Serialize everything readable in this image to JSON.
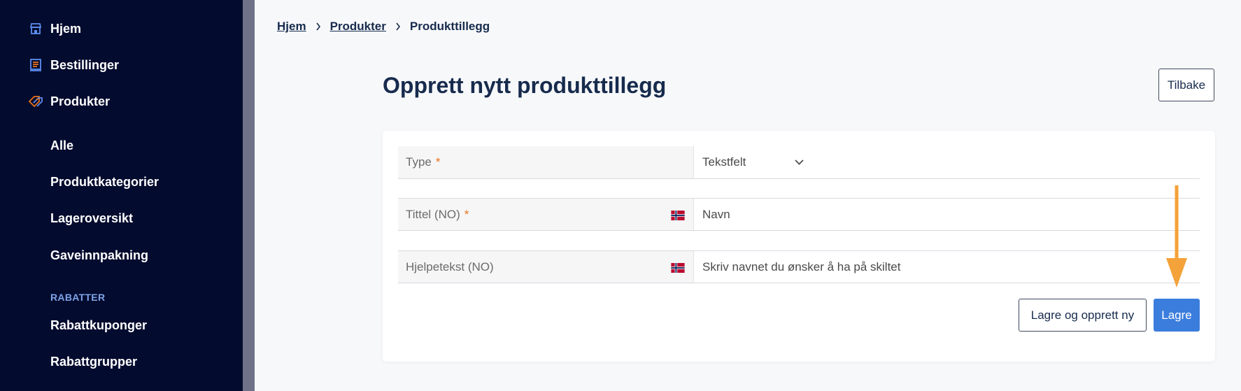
{
  "sidebar": {
    "items": [
      {
        "label": "Hjem",
        "icon": "store-icon"
      },
      {
        "label": "Bestillinger",
        "icon": "orders-icon"
      },
      {
        "label": "Produkter",
        "icon": "tag-icon"
      }
    ],
    "sub_items": [
      "Alle",
      "Produktkategorier",
      "Lageroversikt",
      "Gaveinnpakning"
    ],
    "section_label": "RABATTER",
    "section_items": [
      "Rabattkuponger",
      "Rabattgrupper"
    ]
  },
  "breadcrumb": {
    "items": [
      "Hjem",
      "Produkter"
    ],
    "current": "Produkttillegg"
  },
  "page": {
    "title": "Opprett nytt produkttillegg",
    "back_label": "Tilbake"
  },
  "form": {
    "type_label": "Type",
    "type_value": "Tekstfelt",
    "title_label": "Tittel (NO)",
    "title_value": "Navn",
    "help_label": "Hjelpetekst (NO)",
    "help_value": "Skriv navnet du ønsker å ha på skiltet",
    "required_mark": "*"
  },
  "actions": {
    "save_new_label": "Lagre og opprett ny",
    "save_label": "Lagre"
  },
  "colors": {
    "sidebar_bg": "#030b2e",
    "accent": "#3b7ddd",
    "arrow": "#f4a23a",
    "required": "#e8731d"
  }
}
